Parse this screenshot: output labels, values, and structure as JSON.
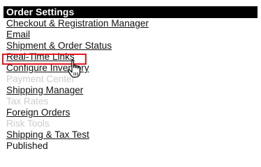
{
  "panel": {
    "title": "Order Settings",
    "items": [
      {
        "label": "Checkout & Registration Manager",
        "state": "link"
      },
      {
        "label": "Email",
        "state": "link"
      },
      {
        "label": "Shipment & Order Status",
        "state": "link"
      },
      {
        "label": "Real-Time Links",
        "state": "link"
      },
      {
        "label": "Configure Inventory",
        "state": "link"
      },
      {
        "label": "Payment Center",
        "state": "disabled"
      },
      {
        "label": "Shipping Manager",
        "state": "link"
      },
      {
        "label": "Tax Rates",
        "state": "disabled"
      },
      {
        "label": "Foreign Orders",
        "state": "link"
      },
      {
        "label": "Risk Tools",
        "state": "disabled"
      },
      {
        "label": "Shipping & Tax Test",
        "state": "link"
      },
      {
        "label": "Published",
        "state": "plain"
      }
    ]
  },
  "colors": {
    "header_bg": "#000000",
    "header_text": "#ffffff",
    "link": "#111111",
    "disabled": "#cccccc",
    "highlight": "#e8161c"
  },
  "cursor": {
    "icon": "hand-pointer-icon"
  }
}
